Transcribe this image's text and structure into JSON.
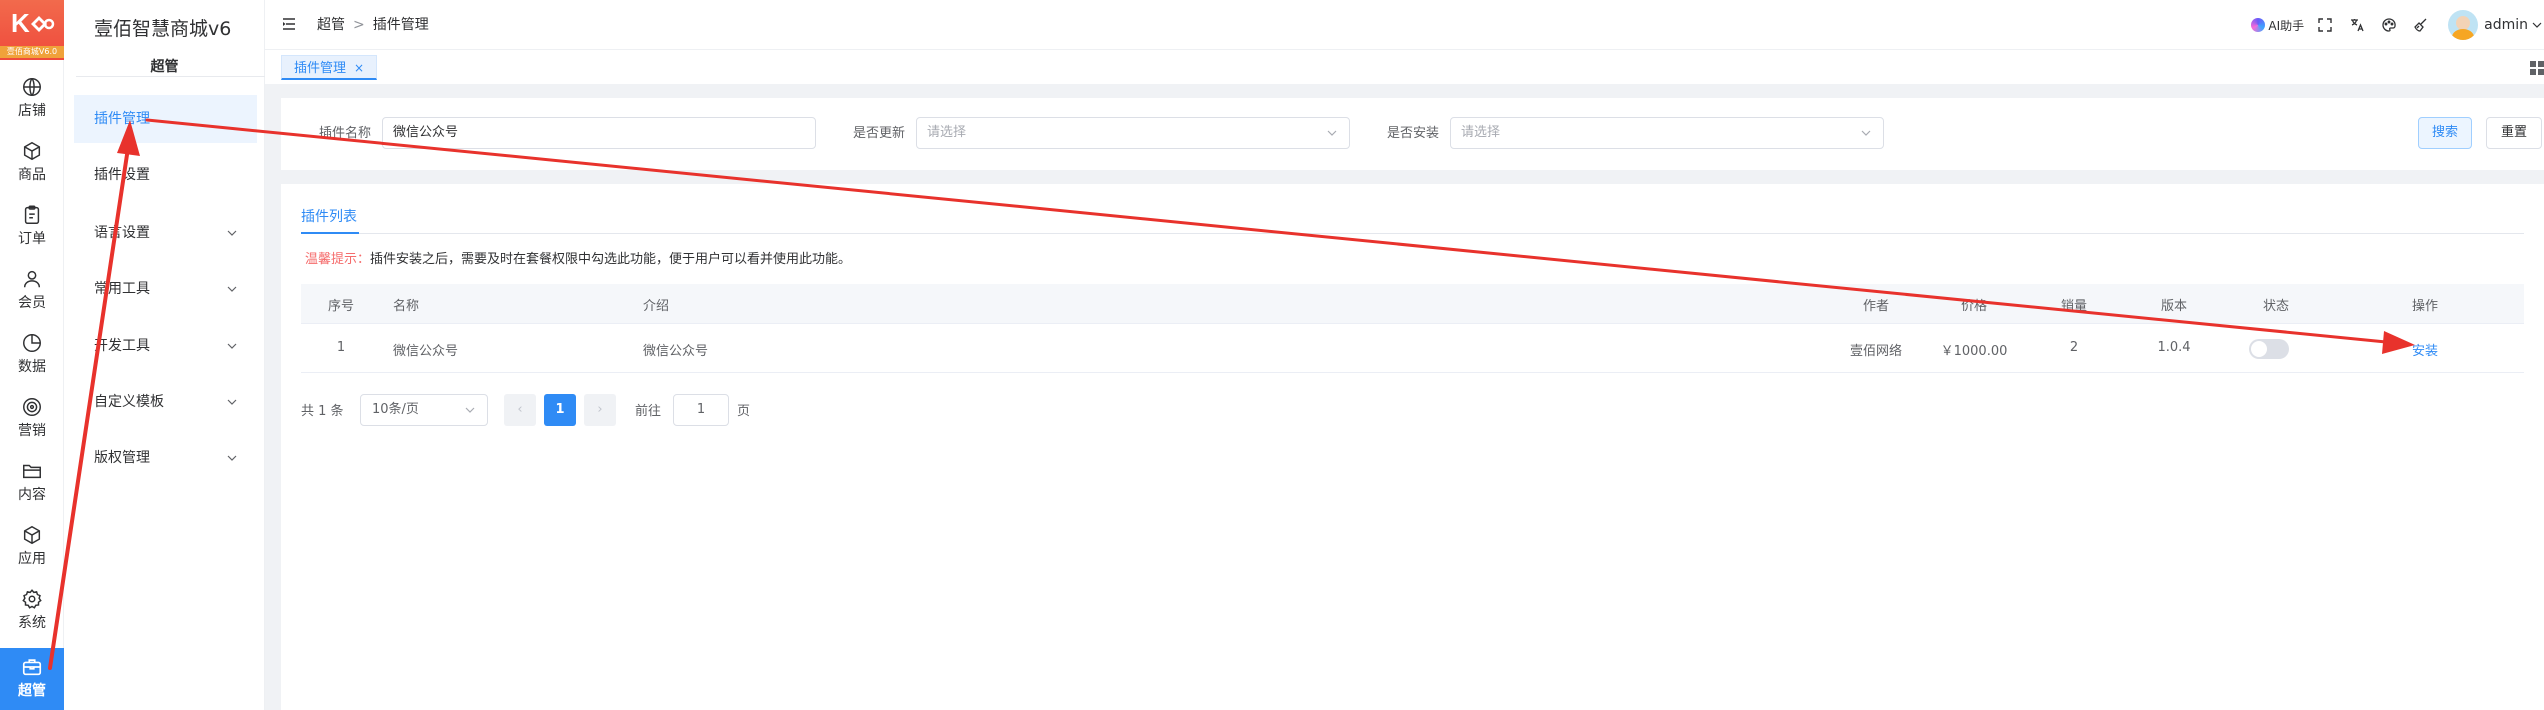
{
  "app": {
    "logo_caption": "壹佰商城V6.0",
    "brand": "壹佰智慧商城v6"
  },
  "rail": {
    "items": [
      {
        "label": "店铺",
        "icon": "globe-icon"
      },
      {
        "label": "商品",
        "icon": "box-icon"
      },
      {
        "label": "订单",
        "icon": "clipboard-icon"
      },
      {
        "label": "会员",
        "icon": "user-icon"
      },
      {
        "label": "数据",
        "icon": "pie-chart-icon"
      },
      {
        "label": "营销",
        "icon": "target-icon"
      },
      {
        "label": "内容",
        "icon": "folder-icon"
      },
      {
        "label": "应用",
        "icon": "cube-icon"
      },
      {
        "label": "系统",
        "icon": "gear-icon"
      },
      {
        "label": "超管",
        "icon": "briefcase-icon"
      }
    ],
    "active_index": 9
  },
  "subnav": {
    "section": "超管",
    "items": [
      {
        "label": "插件管理",
        "active": true,
        "expandable": false
      },
      {
        "label": "插件设置",
        "active": false,
        "expandable": false
      },
      {
        "label": "语言设置",
        "active": false,
        "expandable": true
      },
      {
        "label": "常用工具",
        "active": false,
        "expandable": true
      },
      {
        "label": "开发工具",
        "active": false,
        "expandable": true
      },
      {
        "label": "自定义模板",
        "active": false,
        "expandable": true
      },
      {
        "label": "版权管理",
        "active": false,
        "expandable": true
      }
    ]
  },
  "header": {
    "breadcrumb": [
      "超管",
      "插件管理"
    ],
    "breadcrumb_sep": ">",
    "ai_label": "AI助手",
    "user": "admin"
  },
  "tabs": [
    {
      "label": "插件管理",
      "close": "×"
    }
  ],
  "filter": {
    "name_label": "插件名称",
    "name_value": "微信公众号",
    "update_label": "是否更新",
    "update_placeholder": "请选择",
    "install_label": "是否安装",
    "install_placeholder": "请选择",
    "search_label": "搜索",
    "reset_label": "重置"
  },
  "list": {
    "tab_label": "插件列表",
    "tip_label": "温馨提示：",
    "tip_text": "插件安装之后，需要及时在套餐权限中勾选此功能，便于用户可以看并使用此功能。",
    "columns": [
      "序号",
      "名称",
      "介绍",
      "作者",
      "价格",
      "销量",
      "版本",
      "状态",
      "操作"
    ],
    "rows": [
      {
        "index": "1",
        "name": "微信公众号",
        "intro": "微信公众号",
        "author": "壹佰网络",
        "price": "￥1000.00",
        "sales": "2",
        "version": "1.0.4",
        "status_on": false,
        "action": "安装"
      }
    ]
  },
  "pager": {
    "total": "共 1 条",
    "page_size": "10条/页",
    "prev": "‹",
    "current": "1",
    "next": "›",
    "goto_label": "前往",
    "goto_value": "1",
    "page_suffix": "页"
  },
  "colors": {
    "primary": "#2f8bf5",
    "annotation": "#e8322c",
    "warning_text": "#f56c6c"
  }
}
